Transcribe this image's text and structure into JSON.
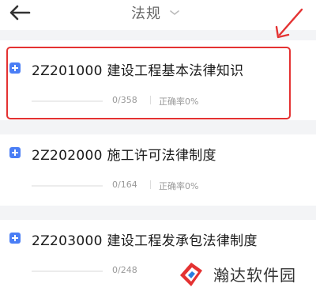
{
  "header": {
    "title": "法规",
    "back_icon": "arrow-left-icon",
    "dropdown_icon": "chevron-down-icon"
  },
  "items": [
    {
      "title": "2Z201000 建设工程基本法律知识",
      "count": "0/358",
      "rate": "正确率0%",
      "progress": 0,
      "highlighted": true
    },
    {
      "title": "2Z202000 施工许可法律制度",
      "count": "0/164",
      "rate": "正确率0%",
      "progress": 0,
      "highlighted": false
    },
    {
      "title": "2Z203000 建设工程发承包法律制度",
      "count": "0/248",
      "rate": "",
      "progress": 0,
      "highlighted": false
    }
  ],
  "watermark": {
    "text": "瀚达软件园"
  },
  "colors": {
    "accent": "#4a7ef5",
    "highlight": "#e43232",
    "background_gap": "#f3f4f6"
  }
}
